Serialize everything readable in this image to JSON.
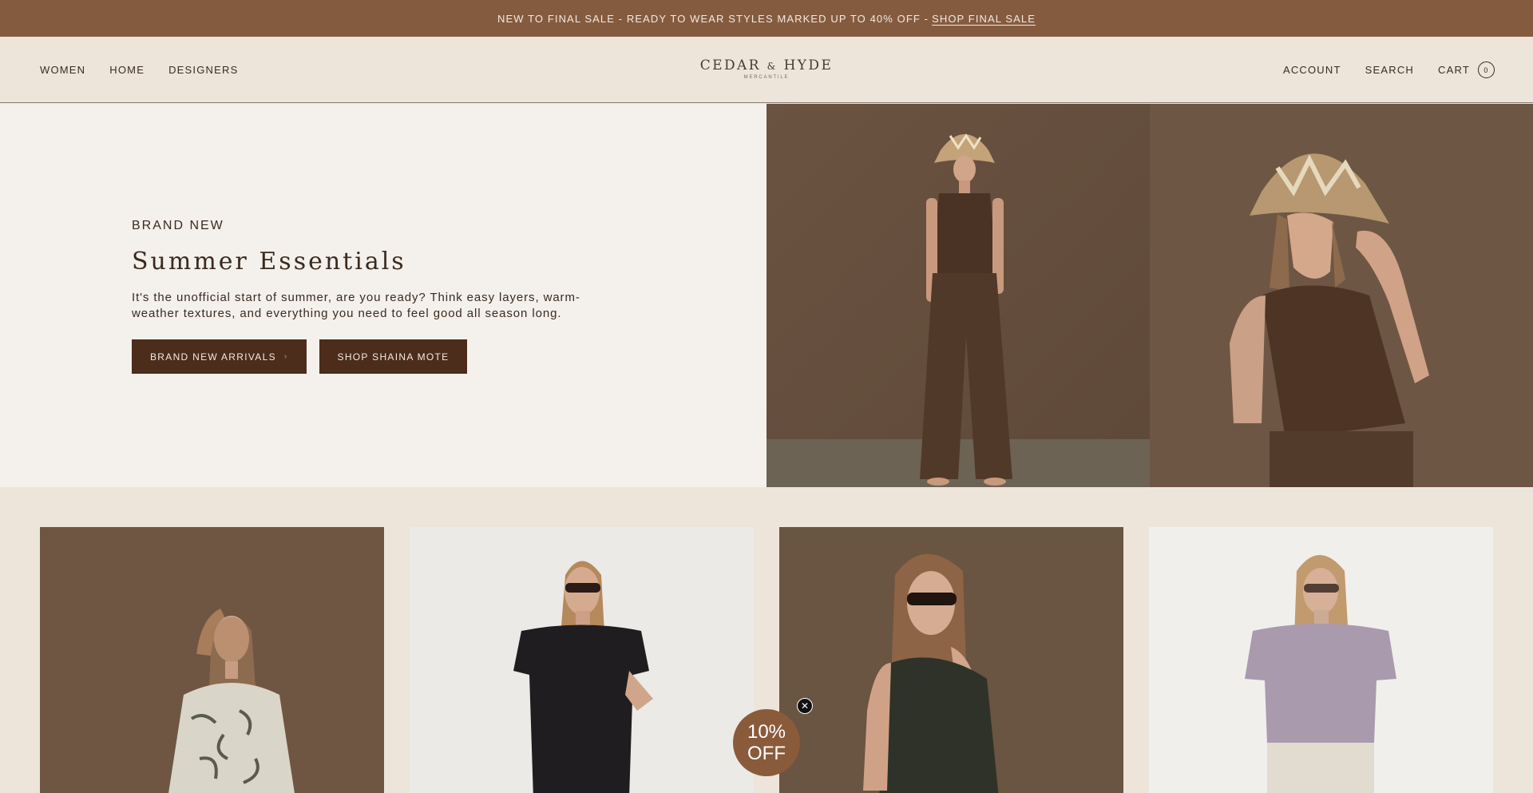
{
  "announcement": {
    "text": "NEW TO FINAL SALE - READY TO WEAR STYLES MARKED UP TO 40% OFF -",
    "link": "SHOP FINAL SALE"
  },
  "header": {
    "nav_left": [
      "WOMEN",
      "HOME",
      "DESIGNERS"
    ],
    "logo": {
      "left": "CEDAR",
      "amp": "&",
      "right": "HYDE",
      "sub": "MERCANTILE"
    },
    "nav_right": {
      "account": "ACCOUNT",
      "search": "SEARCH",
      "cart": "CART",
      "cart_count": "0"
    }
  },
  "hero": {
    "eyebrow": "BRAND NEW",
    "title": "Summer Essentials",
    "text": "It's the unofficial start of summer, are you ready? Think easy layers, warm-weather textures, and everything you need to feel good all season long.",
    "buttons": {
      "primary": "BRAND NEW ARRIVALS",
      "secondary": "SHOP SHAINA MOTE"
    }
  },
  "discount": {
    "line1": "10%",
    "line2": "OFF"
  },
  "colors": {
    "announcement_bg": "#855b40",
    "header_bg": "#ede5da",
    "button_bg": "#4c2c1b",
    "hero_left_bg": "#f4f0ec",
    "badge_bg": "#8a5b3a"
  },
  "icons": {
    "close": "close-icon",
    "chevron": "chevron-right-icon"
  }
}
